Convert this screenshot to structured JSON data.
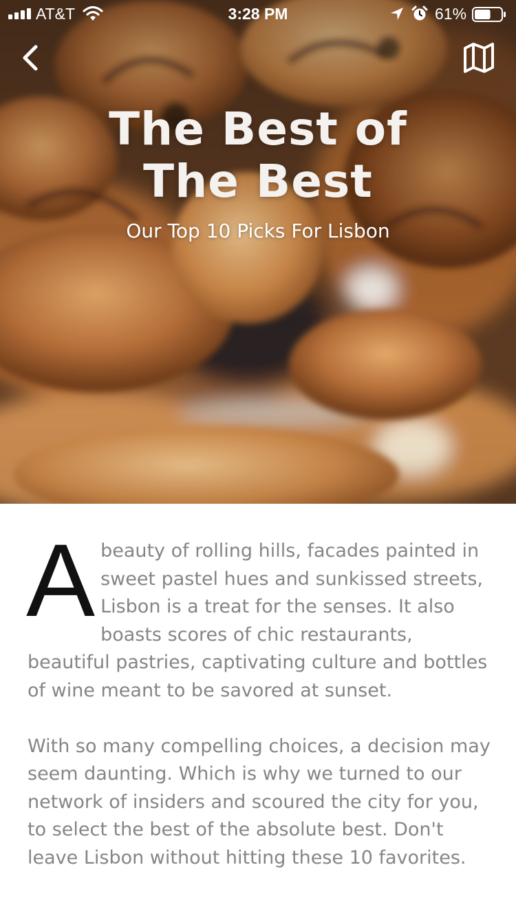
{
  "status_bar": {
    "carrier": "AT&T",
    "time": "3:28 PM",
    "battery_percent": "61%",
    "battery_level": 0.61,
    "icons": [
      "signal-bars-icon",
      "wifi-icon",
      "location-arrow-icon",
      "alarm-clock-icon",
      "battery-icon"
    ]
  },
  "nav": {
    "back_icon": "chevron-left-icon",
    "map_icon": "folded-map-icon"
  },
  "hero": {
    "title_line1": "The Best of",
    "title_line2": "The Best",
    "subtitle": "Our Top 10 Picks For Lisbon"
  },
  "article": {
    "drop_cap": "A",
    "paragraph_1_rest": " beauty of rolling hills, facades painted in sweet pastel hues and sunkissed streets, Lisbon is a treat for the senses. It also boasts scores of chic restaurants, beautiful pastries, captivating culture and bottles of wine meant to be savored at sunset.",
    "paragraph_2": "With so many compelling choices, a decision may seem daunting. Which is why we turned to our network of insiders and scoured the city for you, to select the best of the absolute best. Don't leave Lisbon without hitting these 10 favorites."
  },
  "colors": {
    "body_text": "#858585",
    "drop_cap": "#111111",
    "hero_text": "#ffffff"
  }
}
